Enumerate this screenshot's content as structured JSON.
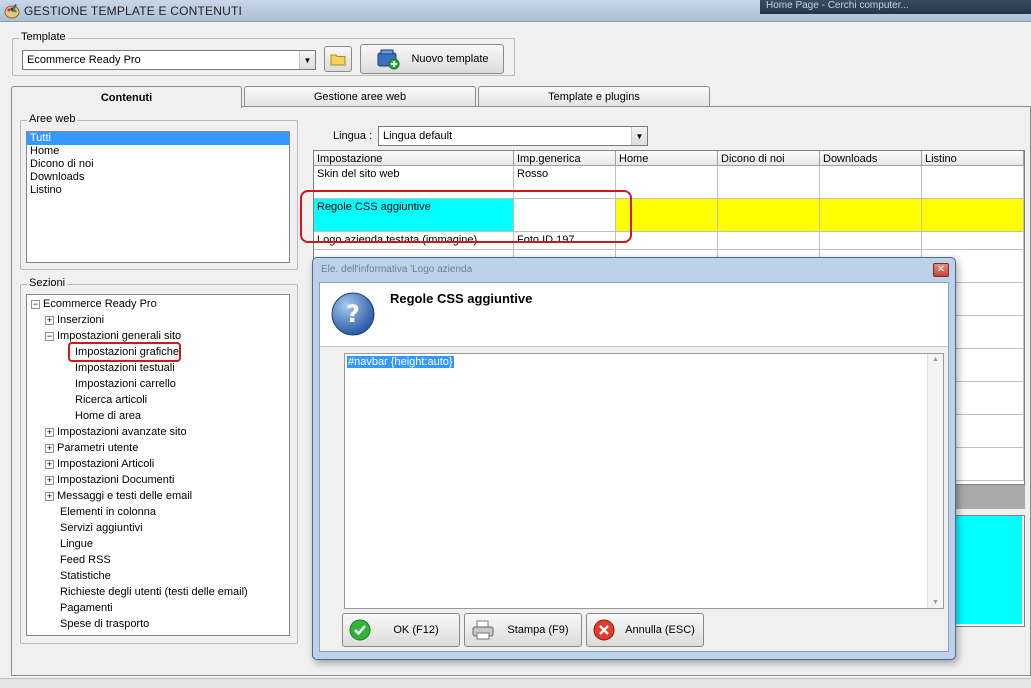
{
  "window": {
    "title": "GESTIONE TEMPLATE E CONTENUTI",
    "background_hint": "Home Page - Cerchi computer..."
  },
  "template_group": {
    "legend": "Template",
    "selected": "Ecommerce Ready Pro",
    "new_button": "Nuovo template"
  },
  "tabs": [
    {
      "label": "Contenuti",
      "active": true
    },
    {
      "label": "Gestione aree web",
      "active": false
    },
    {
      "label": "Template e plugins",
      "active": false
    }
  ],
  "aree_web": {
    "legend": "Aree web",
    "items": [
      "Tutti",
      "Home",
      "Dicono di noi",
      "Downloads",
      "Listino"
    ],
    "selected_index": 0
  },
  "sezioni": {
    "legend": "Sezioni",
    "root": "Ecommerce Ready Pro",
    "rows": [
      {
        "label": "Inserzioni",
        "level": 1,
        "expander": "+"
      },
      {
        "label": "Impostazioni generali sito",
        "level": 1,
        "expander": "-"
      },
      {
        "label": "Impostazioni grafiche",
        "level": 2,
        "expander": ""
      },
      {
        "label": "Impostazioni testuali",
        "level": 2,
        "expander": ""
      },
      {
        "label": "Impostazioni carrello",
        "level": 2,
        "expander": ""
      },
      {
        "label": "Ricerca articoli",
        "level": 2,
        "expander": ""
      },
      {
        "label": "Home di area",
        "level": 2,
        "expander": ""
      },
      {
        "label": "Impostazioni avanzate sito",
        "level": 1,
        "expander": "+"
      },
      {
        "label": "Parametri utente",
        "level": 1,
        "expander": "+"
      },
      {
        "label": "Impostazioni Articoli",
        "level": 1,
        "expander": "+"
      },
      {
        "label": "Impostazioni Documenti",
        "level": 1,
        "expander": "+"
      },
      {
        "label": "Messaggi e testi delle email",
        "level": 1,
        "expander": "+"
      },
      {
        "label": "Elementi in colonna",
        "level": 1,
        "expander": ""
      },
      {
        "label": "Servizi aggiuntivi",
        "level": 1,
        "expander": ""
      },
      {
        "label": "Lingue",
        "level": 1,
        "expander": ""
      },
      {
        "label": "Feed RSS",
        "level": 1,
        "expander": ""
      },
      {
        "label": "Statistiche",
        "level": 1,
        "expander": ""
      },
      {
        "label": "Richieste degli utenti (testi delle email)",
        "level": 1,
        "expander": ""
      },
      {
        "label": "Pagamenti",
        "level": 1,
        "expander": ""
      },
      {
        "label": "Spese di trasporto",
        "level": 1,
        "expander": ""
      }
    ]
  },
  "lingua": {
    "label": "Lingua :",
    "selected": "Lingua default"
  },
  "grid": {
    "headers": [
      "Impostazione",
      "Imp.generica",
      "Home",
      "Dicono di noi",
      "Downloads",
      "Listino"
    ],
    "rows": [
      [
        "Skin del sito web",
        "Rosso",
        "",
        "",
        "",
        ""
      ],
      [
        "Regole CSS aggiuntive",
        "",
        "",
        "",
        "",
        ""
      ],
      [
        "Logo azienda testata (immagine)",
        "Foto ID 197",
        "",
        "",
        "",
        ""
      ]
    ]
  },
  "dialog": {
    "title": "Regole CSS aggiuntive",
    "ghost_title": "Ele. dell'informativa 'Logo azienda",
    "content": "#navbar {height:auto}",
    "buttons": {
      "ok": "OK (F12)",
      "print": "Stampa (F9)",
      "cancel": "Annulla (ESC)"
    }
  },
  "colors": {
    "selection": "#3399ff",
    "highlight_cyan": "#00ffff",
    "highlight_yellow": "#ffff00",
    "annotation_red": "#cc1a1a"
  }
}
